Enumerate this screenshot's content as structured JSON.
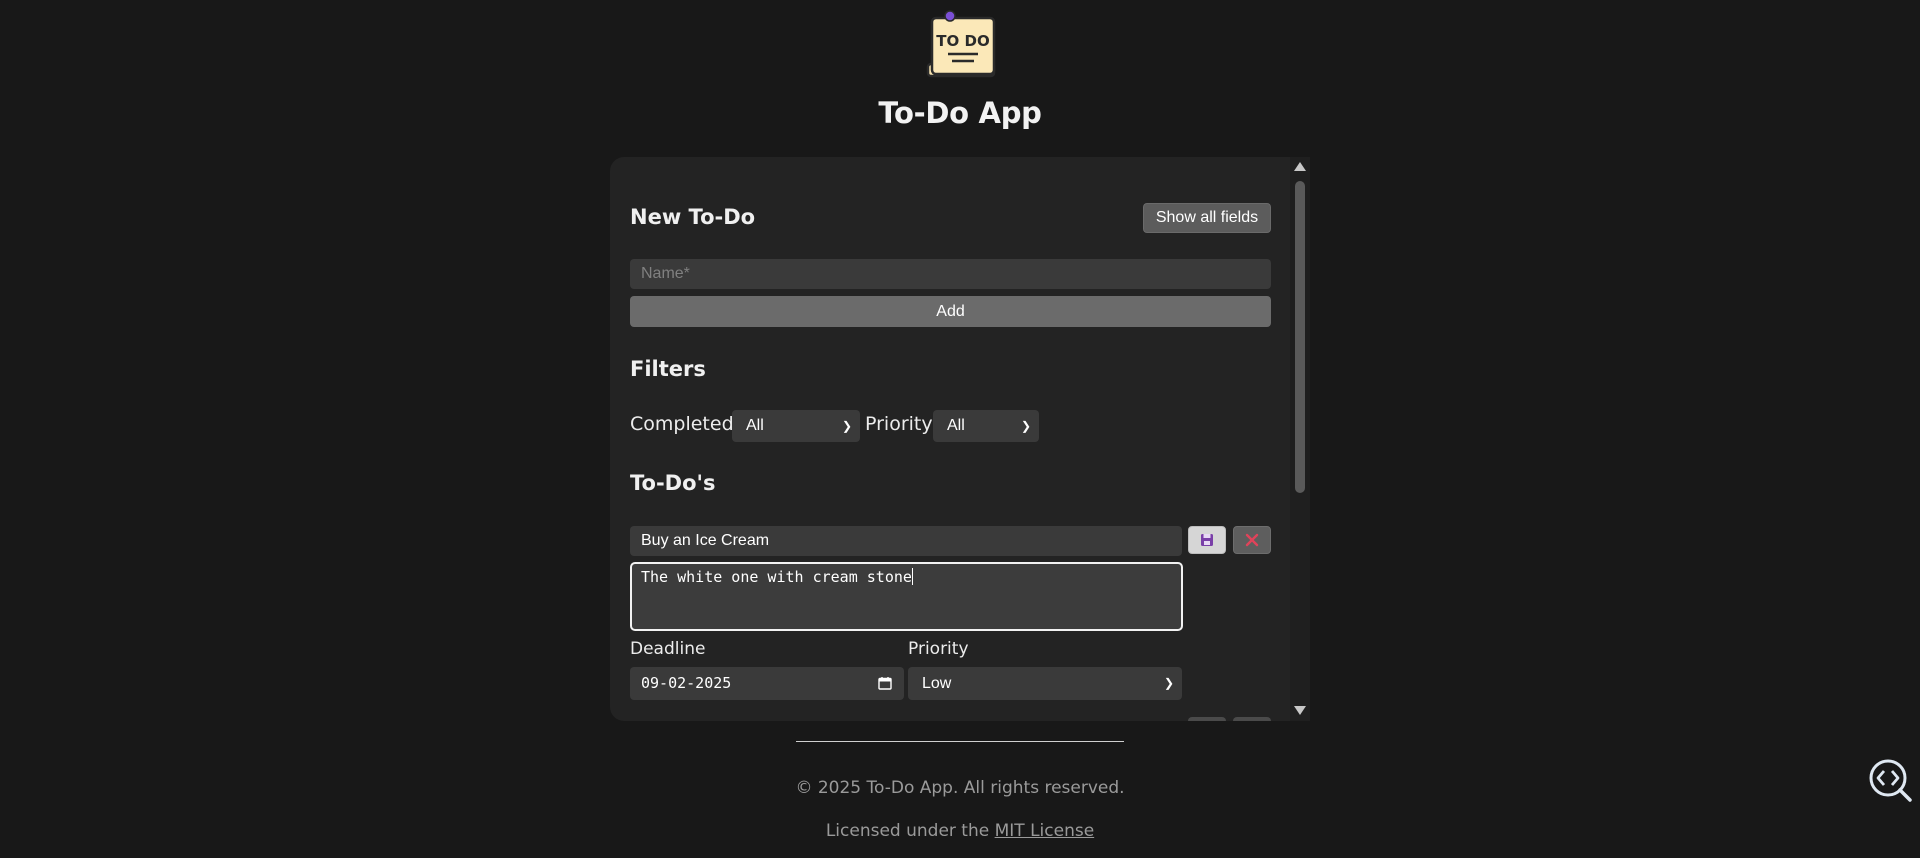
{
  "app": {
    "title": "To-Do App",
    "logo_text": "TO DO"
  },
  "new_todo": {
    "heading": "New To-Do",
    "show_all_fields_label": "Show all fields",
    "name_placeholder": "Name*",
    "add_label": "Add"
  },
  "filters": {
    "heading": "Filters",
    "completed_label": "Completed",
    "completed_value": "All",
    "priority_label": "Priority",
    "priority_value": "All"
  },
  "todos": {
    "heading": "To-Do's",
    "items": [
      {
        "name": "Buy an Ice Cream",
        "description": "The white one with cream stone",
        "deadline_label": "Deadline",
        "deadline_value": "09-02-2025",
        "priority_label": "Priority",
        "priority_value": "Low"
      }
    ]
  },
  "footer": {
    "copyright": "© 2025 To-Do App. All rights reserved.",
    "license_prefix": "Licensed under the ",
    "license_link": "MIT License"
  },
  "colors": {
    "background": "#181818",
    "panel": "#232323",
    "input": "#3a3a3a",
    "delete_x": "#e0435a",
    "save_icon": "#7a3fa8"
  },
  "icons": {
    "logo": "todo-note-icon",
    "save": "floppy-disk-icon",
    "delete": "close-icon",
    "calendar": "calendar-icon",
    "chevron": "chevron-down-icon",
    "dev": "code-search-icon"
  }
}
